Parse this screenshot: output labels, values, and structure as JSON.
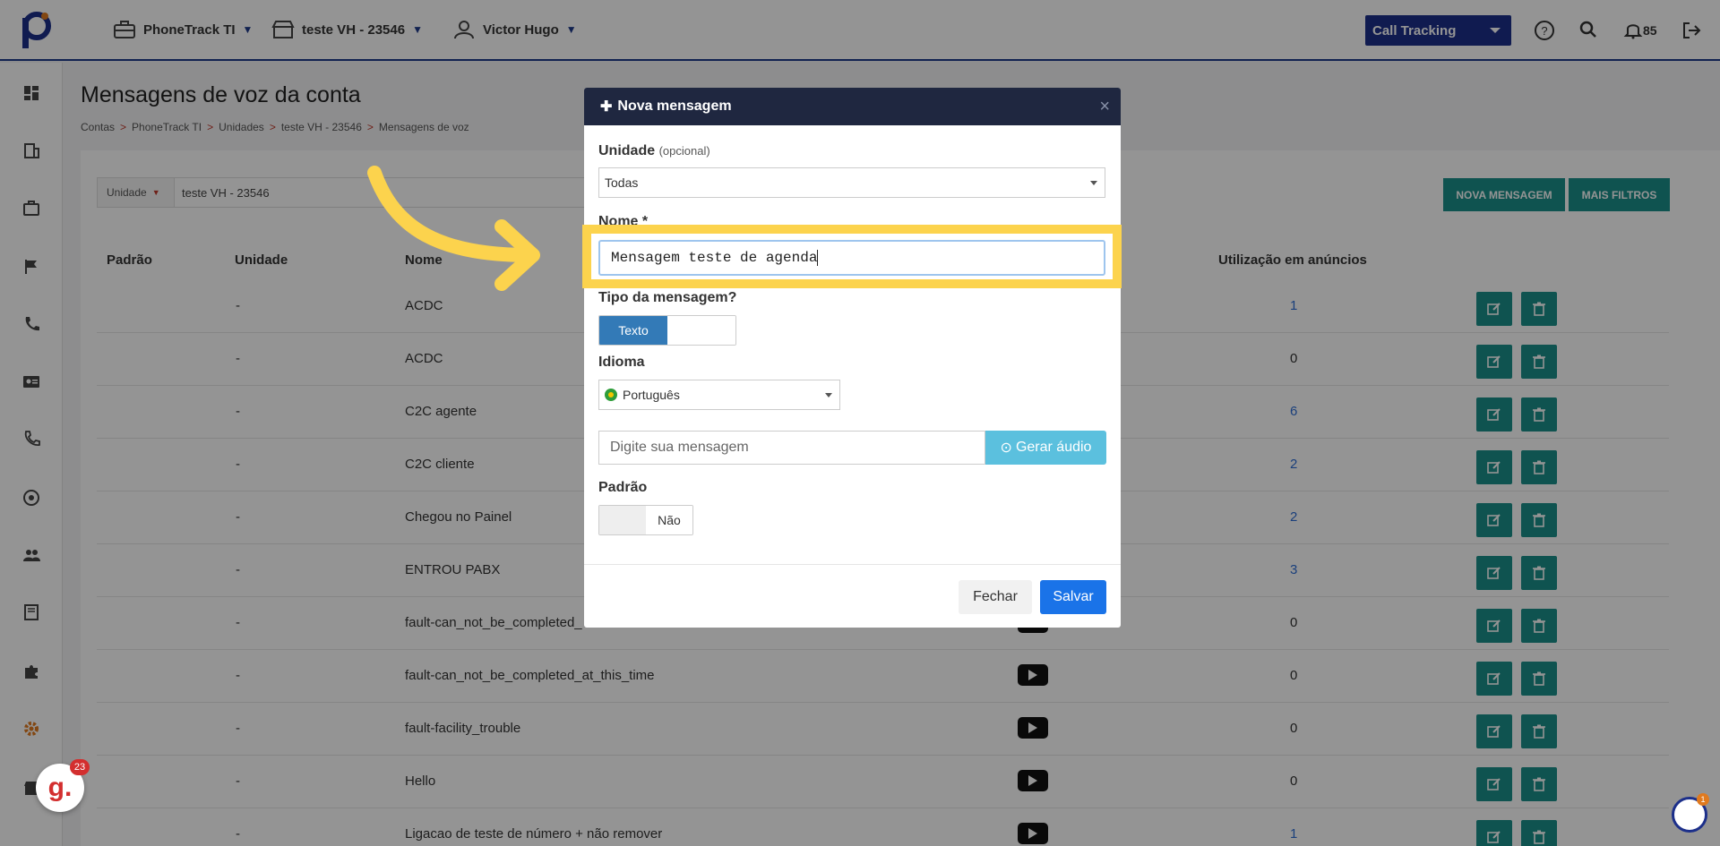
{
  "topbar": {
    "account": "PhoneTrack TI",
    "unit": "teste VH - 23546",
    "user": "Victor Hugo",
    "product_select": "Call Tracking",
    "notifications": "85"
  },
  "page": {
    "title": "Mensagens de voz da conta",
    "breadcrumb": [
      "Contas",
      "PhoneTrack TI",
      "Unidades",
      "teste VH - 23546",
      "Mensagens de voz"
    ],
    "breadcrumb_sep": ">"
  },
  "filter": {
    "label": "Unidade",
    "value": "teste VH - 23546"
  },
  "buttons": {
    "new_message": "NOVA MENSAGEM",
    "more_filters": "MAIS FILTROS"
  },
  "table": {
    "headers": {
      "padrao": "Padrão",
      "unidade": "Unidade",
      "nome": "Nome",
      "utilizacao": "Utilização em anúncios"
    },
    "rows": [
      {
        "unidade": "-",
        "nome": "ACDC",
        "uso": "1",
        "link": true,
        "play": false
      },
      {
        "unidade": "-",
        "nome": "ACDC",
        "uso": "0",
        "link": false,
        "play": false
      },
      {
        "unidade": "-",
        "nome": "C2C agente",
        "uso": "6",
        "link": true,
        "play": false
      },
      {
        "unidade": "-",
        "nome": "C2C cliente",
        "uso": "2",
        "link": true,
        "play": false
      },
      {
        "unidade": "-",
        "nome": "Chegou no Painel",
        "uso": "2",
        "link": true,
        "play": false
      },
      {
        "unidade": "-",
        "nome": "ENTROU PABX",
        "uso": "3",
        "link": true,
        "play": false
      },
      {
        "unidade": "-",
        "nome": "fault-can_not_be_completed_",
        "uso": "0",
        "link": false,
        "play": true
      },
      {
        "unidade": "-",
        "nome": "fault-can_not_be_completed_at_this_time",
        "uso": "0",
        "link": false,
        "play": true
      },
      {
        "unidade": "-",
        "nome": "fault-facility_trouble",
        "uso": "0",
        "link": false,
        "play": true
      },
      {
        "unidade": "-",
        "nome": "Hello",
        "uso": "0",
        "link": false,
        "play": true
      },
      {
        "unidade": "-",
        "nome": "Ligacao de teste de número + não remover",
        "uso": "1",
        "link": true,
        "play": true
      }
    ]
  },
  "modal": {
    "title": "Nova mensagem",
    "unit_label": "Unidade",
    "unit_optional": "(opcional)",
    "unit_value": "Todas",
    "name_label": "Nome *",
    "name_value": "Mensagem teste de agenda",
    "type_label": "Tipo da mensagem?",
    "type_value": "Texto",
    "language_label": "Idioma",
    "language_value": "Português",
    "message_placeholder": "Digite sua mensagem",
    "generate_audio": "Gerar áudio",
    "default_label": "Padrão",
    "default_value": "Não",
    "close_button": "Fechar",
    "save_button": "Salvar"
  },
  "badges": {
    "g_count": "23",
    "p_count": "1"
  },
  "colors": {
    "brand_navy": "#1c2f8a",
    "teal": "#1b8f8a",
    "highlight": "#fcd34d",
    "save_blue": "#1a73e8"
  }
}
